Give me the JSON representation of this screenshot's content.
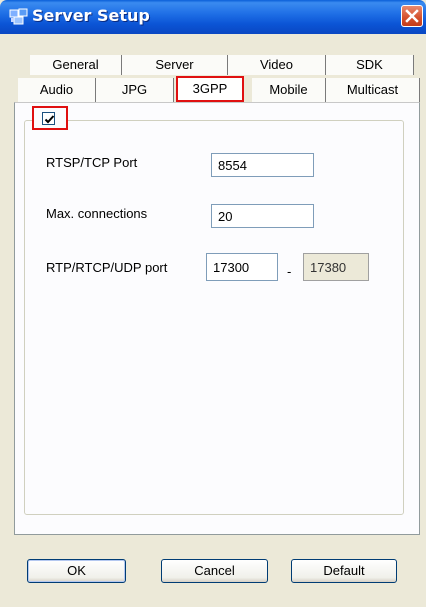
{
  "window": {
    "title": "Server Setup"
  },
  "tabs": {
    "row1": [
      "General",
      "Server",
      "Video",
      "SDK"
    ],
    "row2": [
      "Audio",
      "JPG",
      "3GPP",
      "Mobile",
      "Multicast"
    ],
    "active": "3GPP"
  },
  "group": {
    "enabled": true
  },
  "fields": {
    "rtsp_port": {
      "label": "RTSP/TCP Port",
      "value": "8554"
    },
    "max_connections": {
      "label": "Max. connections",
      "value": "20"
    },
    "rtp_port": {
      "label": "RTP/RTCP/UDP port",
      "start": "17300",
      "separator": "-",
      "end": "17380"
    }
  },
  "buttons": {
    "ok": "OK",
    "cancel": "Cancel",
    "default": "Default"
  },
  "colors": {
    "highlight": "#e01010",
    "titlebar": "#0b55d6",
    "close": "#d4502c"
  }
}
